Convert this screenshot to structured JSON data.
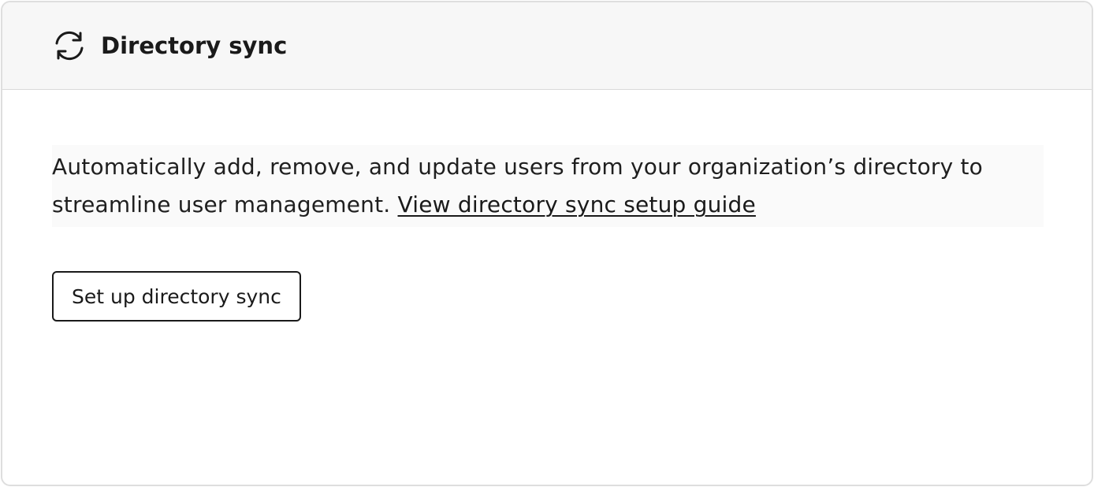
{
  "header": {
    "icon": "sync-icon",
    "title": "Directory sync"
  },
  "body": {
    "description": "Automatically add, remove, and update users from your organization’s directory to streamline user management.",
    "link_label": "View directory sync setup guide",
    "button_label": "Set up directory sync"
  },
  "colors": {
    "header_background": "#f7f7f7",
    "border": "#dedede",
    "text": "#1a1a1a"
  }
}
